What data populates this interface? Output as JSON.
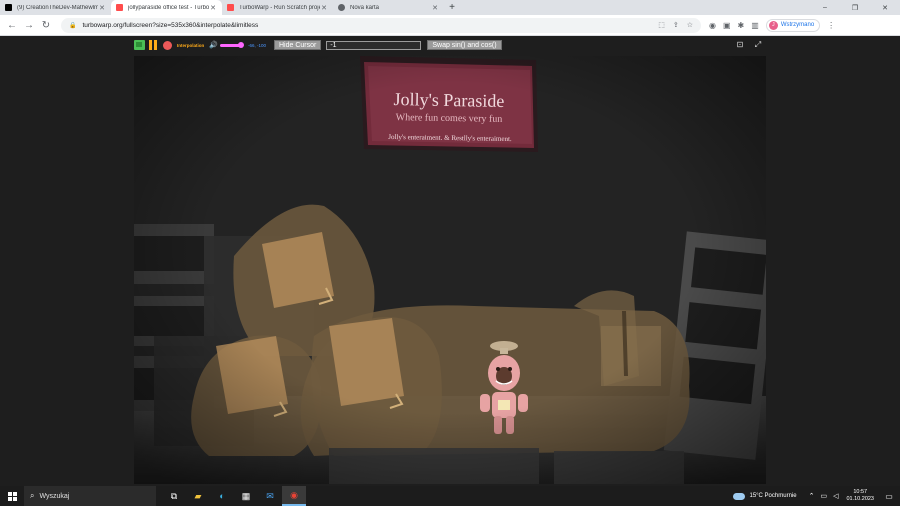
{
  "tabs": [
    {
      "title": "(9) CreationTheDev-Mathewlmc",
      "icon": "tiktok-icon",
      "color": "#000000",
      "active": false
    },
    {
      "title": "jollyparaside office test - Turbo",
      "icon": "turbowarp-icon",
      "color": "#ff4c4c",
      "active": true
    },
    {
      "title": "TurboWarp - Run Scratch projec",
      "icon": "turbowarp-icon",
      "color": "#ff4c4c",
      "active": false
    },
    {
      "title": "Nova karta",
      "icon": "globe-icon",
      "color": "#5f6368",
      "active": false
    }
  ],
  "newtab_label": "+",
  "window_controls": {
    "minimize": "–",
    "maximize": "❐",
    "close": "✕"
  },
  "address_bar": {
    "url": "turbowarp.org/fullscreen?size=535x360&interpolate&limitless"
  },
  "profile": {
    "initial": "J",
    "label": "Wstrzymano"
  },
  "player": {
    "interpolation_label": "Interpolation",
    "coords": "-66, -100",
    "hide_cursor_label": "Hide Cursor",
    "input_value": "-1",
    "swap_label": "Swap sin() and cos()"
  },
  "sign": {
    "title": "Jolly's Paraside",
    "subtitle": "Where fun comes very fun",
    "footer": "Jolly's enteraiment. & Restlly's enteraiment."
  },
  "taskbar": {
    "search_placeholder": "Wyszukaj",
    "weather": "15°C  Pochmurnie",
    "time": "10:57",
    "date": "01.10.2023"
  },
  "colors": {
    "accent_orange": "#ffab19",
    "accent_pink": "#ff66ff",
    "flag_green": "#4cbf56",
    "stop_red": "#ec5959",
    "sign_color": "#7b2d3e"
  }
}
